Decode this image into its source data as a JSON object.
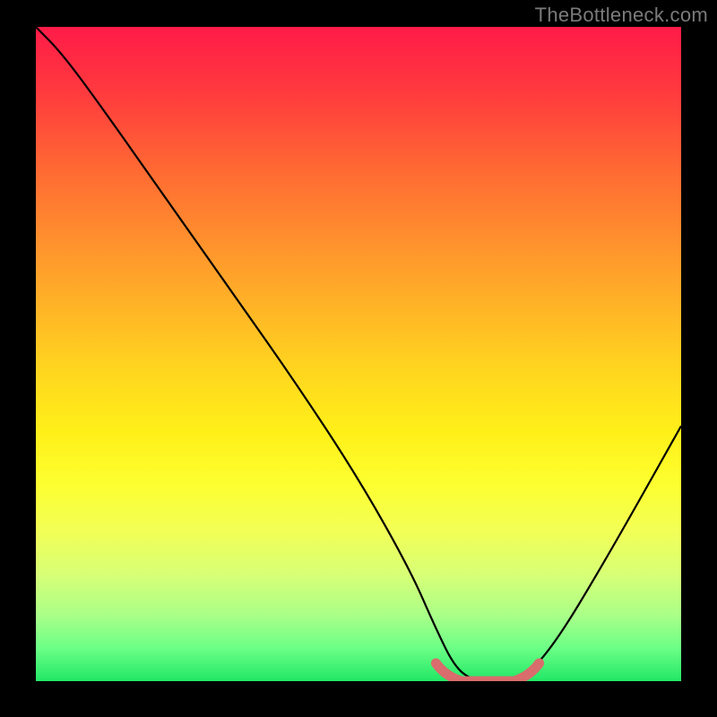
{
  "watermark": "TheBottleneck.com",
  "chart_data": {
    "type": "line",
    "title": "",
    "xlabel": "",
    "ylabel": "",
    "xlim": [
      0,
      100
    ],
    "ylim": [
      0,
      100
    ],
    "series": [
      {
        "name": "bottleneck-curve",
        "x": [
          0,
          4,
          10,
          20,
          30,
          40,
          50,
          58,
          62,
          65,
          68,
          72,
          75,
          80,
          88,
          100
        ],
        "values": [
          100,
          96,
          88,
          74,
          60,
          46,
          31,
          17,
          8,
          2,
          0,
          0,
          0,
          5,
          18,
          39
        ]
      }
    ],
    "highlight": {
      "x_start": 62,
      "x_end": 78,
      "y": 0
    },
    "colors": {
      "curve": "#000000",
      "highlight": "#d96c6c",
      "gradient_top": "#ff1b48",
      "gradient_bottom": "#22e765"
    }
  }
}
